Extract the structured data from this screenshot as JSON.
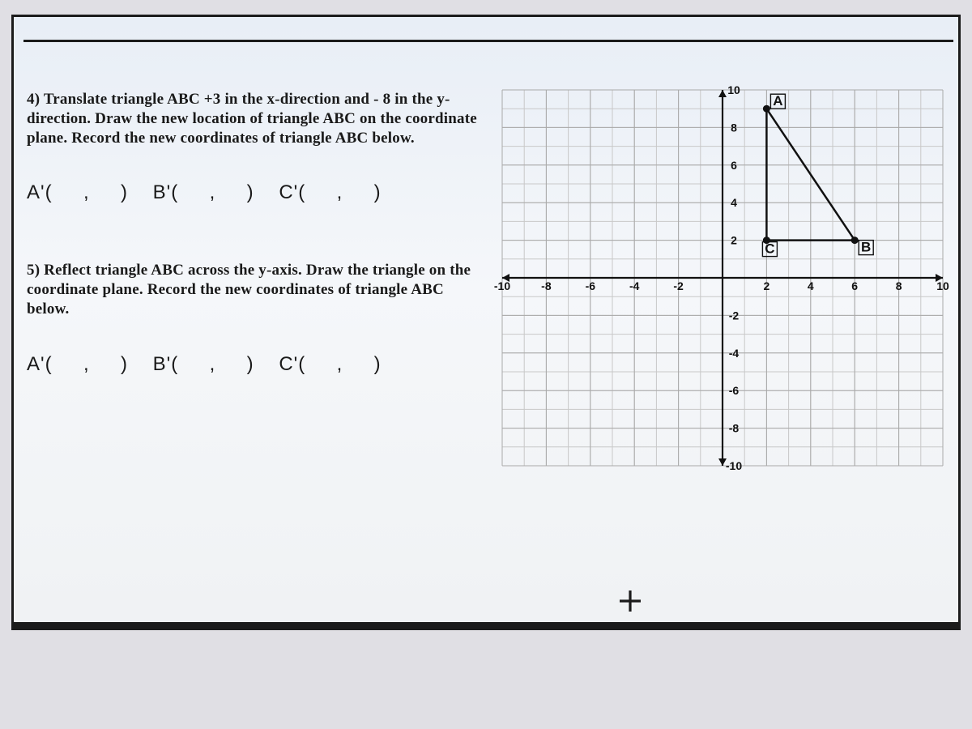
{
  "questions": {
    "q4": {
      "text": "4) Translate triangle ABC +3 in the x-direction and - 8 in the y-direction.  Draw the new location of triangle ABC on the coordinate plane.  Record the new coordinates of triangle ABC below.",
      "answers": {
        "a_label": "A'(",
        "a_sep": ",",
        "a_close": ")",
        "b_label": "B'(",
        "b_sep": ",",
        "b_close": ")",
        "c_label": "C'(",
        "c_sep": ",",
        "c_close": ")"
      }
    },
    "q5": {
      "text": "5) Reflect triangle ABC across the y-axis.  Draw the triangle on the coordinate plane.  Record the new coordinates of triangle ABC below.",
      "answers": {
        "a_label": "A'(",
        "a_sep": ",",
        "a_close": ")",
        "b_label": "B'(",
        "b_sep": ",",
        "b_close": ")",
        "c_label": "C'(",
        "c_sep": ",",
        "c_close": ")"
      }
    }
  },
  "chart_data": {
    "type": "scatter",
    "title": "",
    "xlabel": "",
    "ylabel": "",
    "xlim": [
      -10,
      10
    ],
    "ylim": [
      -10,
      10
    ],
    "x_ticks": [
      "-10",
      "-8",
      "-6",
      "-4",
      "-2",
      "2",
      "4",
      "6",
      "8",
      "10"
    ],
    "y_ticks": [
      "10",
      "8",
      "6",
      "4",
      "2",
      "-2",
      "-4",
      "-6",
      "-8",
      "-10"
    ],
    "series": [
      {
        "name": "triangle ABC",
        "points": [
          {
            "label": "A",
            "x": 2,
            "y": 9
          },
          {
            "label": "B",
            "x": 6,
            "y": 2
          },
          {
            "label": "C",
            "x": 2,
            "y": 2
          }
        ]
      }
    ]
  },
  "toolbar": {
    "plus_title": "+"
  }
}
